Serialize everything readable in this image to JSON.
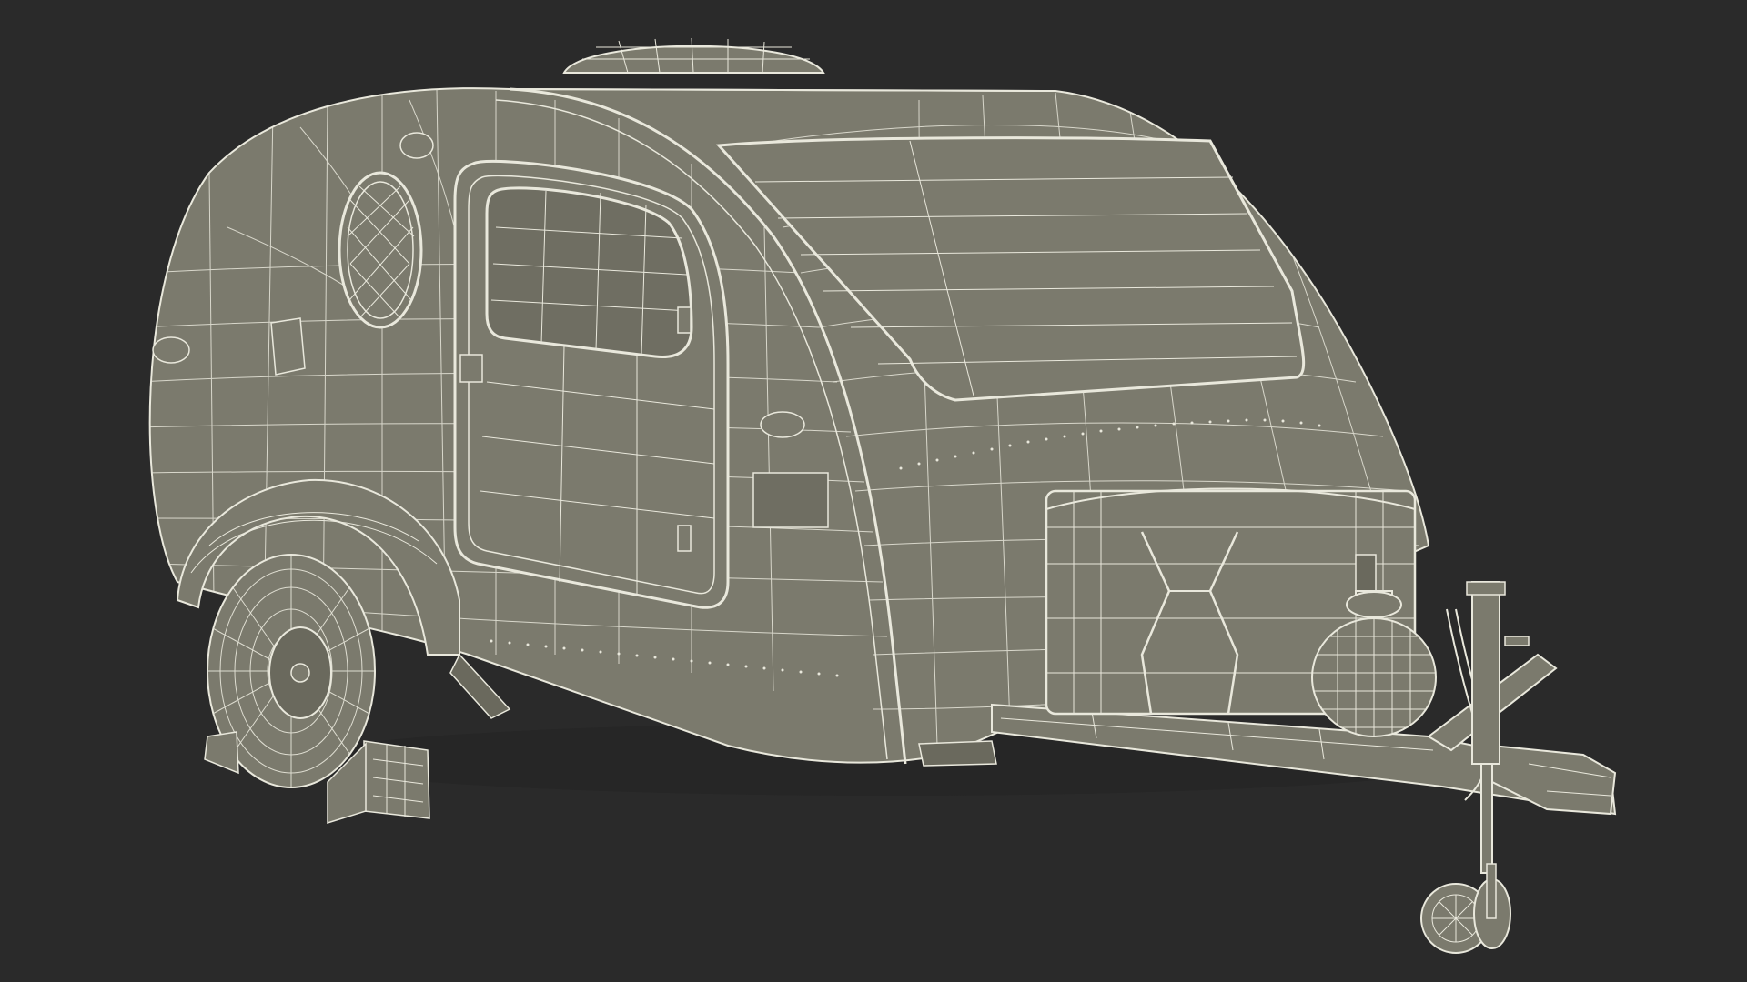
{
  "scene": {
    "subject": "teardrop-trailer-wireframe",
    "background_color": "#2a2a2a",
    "surface_color": "#7b7a6d",
    "surface_dark_color": "#6a695d",
    "wire_color": "#e9e8dc"
  }
}
